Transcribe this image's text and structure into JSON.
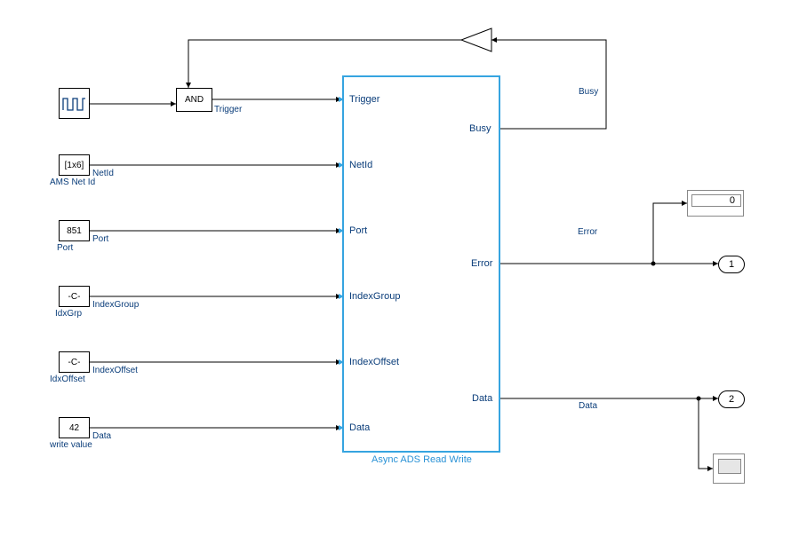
{
  "main_block": {
    "title": "Async ADS Read Write",
    "inputs": [
      "Trigger",
      "NetId",
      "Port",
      "IndexGroup",
      "IndexOffset",
      "Data"
    ],
    "outputs": [
      "Busy",
      "Error",
      "Data"
    ]
  },
  "sources": {
    "pulse": {
      "signal_label": ""
    },
    "netid": {
      "value": "[1x6]",
      "signal_label": "NetId",
      "block_name": "AMS Net Id"
    },
    "port": {
      "value": "851",
      "signal_label": "Port",
      "block_name": "Port"
    },
    "idxgrp": {
      "value": "-C-",
      "signal_label": "IndexGroup",
      "block_name": "IdxGrp"
    },
    "idxoff": {
      "value": "-C-",
      "signal_label": "IndexOffset",
      "block_name": "IdxOffset"
    },
    "wval": {
      "value": "42",
      "signal_label": "Data",
      "block_name": "write value"
    }
  },
  "and_block": {
    "label": "AND",
    "signal_label": "Trigger"
  },
  "output_signal_labels": {
    "busy": "Busy",
    "error": "Error",
    "data": "Data"
  },
  "display": {
    "value": "0"
  },
  "outports": {
    "one": "1",
    "two": "2"
  }
}
